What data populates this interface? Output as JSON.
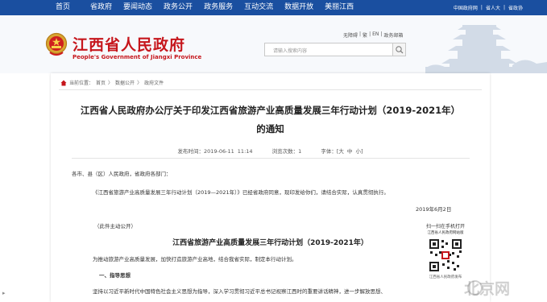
{
  "topnav": {
    "items": [
      "首页",
      "省政府",
      "要闻动态",
      "政务公开",
      "政务服务",
      "互动交流",
      "数据开放",
      "美丽江西"
    ],
    "right": [
      "中国政府网",
      "|",
      "省人大",
      "|",
      "省政协"
    ]
  },
  "header": {
    "site_title": "江西省人民政府",
    "site_subtitle": "People's Government of Jiangxi Province",
    "tools": [
      "无障碍",
      "|",
      "繁",
      "|",
      "EN",
      "|",
      "政务邮箱"
    ],
    "search_placeholder": "请输入搜索内容"
  },
  "breadcrumb": {
    "label": "当前位置：",
    "items": [
      "首页",
      "数据公开",
      "政府文件"
    ],
    "separator": "〉"
  },
  "article": {
    "title_line1": "江西省人民政府办公厅关于印发江西省旅游产业高质量发展三年行动计划（2019-2021年）",
    "title_line2": "的通知",
    "meta": {
      "published": "发布时间：2019-06-11 11:14",
      "views": "浏览次数：1",
      "font": "字体：[大 中 小]"
    },
    "paragraphs": {
      "salutation": "各市、县（区）人民政府，省政府各部门：",
      "body1": "《江西省旅游产业高质量发展三年行动计划（2019—2021年）》已经省政府同意，现印发给你们，请结合实际，认真贯彻执行。",
      "date": "2019年6月2日",
      "note": "（此件主动公开）",
      "plan_title": "江西省旅游产业高质量发展三年行动计划（2019-2021年）",
      "body2": "为推动旅游产业高质量发展，加快打造旅游产业高地，结合我省实际，制定本行动计划。",
      "heading1": "一、指导思想",
      "body3": "坚持以习近平新时代中国特色社会主义思想为指导，深入学习贯彻习近平总书记视察江西时的重要讲话精神，进一步解放思想、"
    }
  },
  "qr": {
    "title": "扫一扫在手机打开",
    "subtitle": "江西省人民政府网站版",
    "caption": "江西省人民政府发布"
  },
  "watermark": "北京网"
}
